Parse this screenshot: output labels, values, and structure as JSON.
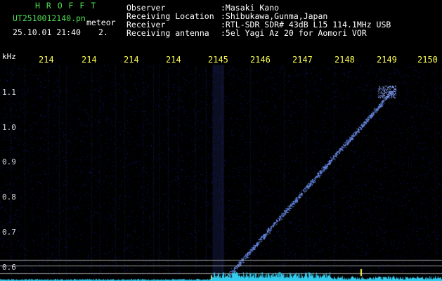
{
  "app": {
    "logo_text": "H R O F F T",
    "filename": "UT2510012140.pn",
    "event_label": "meteor",
    "datetime": "25.10.01 21:40",
    "count": "2."
  },
  "info": {
    "observer_label": "Observer",
    "observer_value": ":Masaki Kano",
    "location_label": "Receiving Location",
    "location_value": ":Shibukawa,Gunma,Japan",
    "receiver_label": "Receiver",
    "receiver_value": ":RTL-SDR SDR# 43dB L15 114.1MHz USB",
    "antenna_label": "Receiving antenna",
    "antenna_value": ":5el Yagi Az 20 for Aomori VOR"
  },
  "axes": {
    "unit": "kHz",
    "top_ticks": [
      "214",
      "214",
      "214",
      "214",
      "2145",
      "2146",
      "2147",
      "2148",
      "2149",
      "2150"
    ],
    "freq_ticks": [
      "1.1",
      "1.0",
      "0.9",
      "0.8",
      "0.7",
      "0.6"
    ]
  },
  "colors": {
    "background": "#000000",
    "trace": "#7aa0ff",
    "spectrum": "#33ccee",
    "header_green": "#4ee04e",
    "tick_yellow": "#ffff55"
  }
}
